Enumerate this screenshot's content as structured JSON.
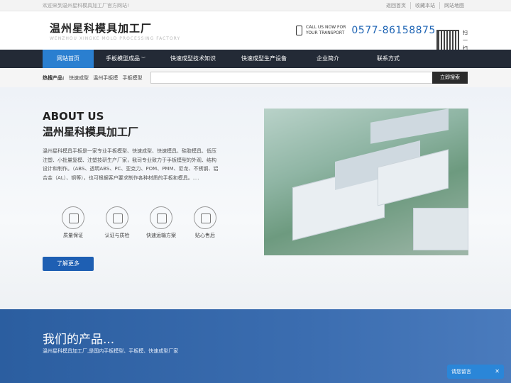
{
  "topbar": {
    "welcome": "欢迎来到温州星科模具加工厂官方网站!",
    "links": [
      "返回首页",
      "收藏本站",
      "网站地图"
    ]
  },
  "header": {
    "brand_cn": "温州星科模具加工厂",
    "brand_en": "WENZHOU XINGKE MOLD PROCESSING FACTORY",
    "call_line1": "CALL US NOW FOR",
    "call_line2": "YOUR TRANSPORT",
    "phone": "0577-86158875",
    "qr_label": "扫一扫"
  },
  "nav": {
    "items": [
      {
        "label": "网站首页",
        "active": true
      },
      {
        "label": "手板模型成品"
      },
      {
        "label": "快速成型技术知识"
      },
      {
        "label": "快速成型生产设备"
      },
      {
        "label": "企业简介"
      },
      {
        "label": "联系方式"
      }
    ]
  },
  "search": {
    "hot_label": "热搜产品:",
    "hot_items": [
      "快速成型",
      "温州手板模",
      "手板模型"
    ],
    "placeholder": "",
    "button": "立即搜索"
  },
  "about": {
    "title_en": "ABOUT US",
    "title_cn": "温州星科模具加工厂",
    "text": "温州星科模具手板是一家专业手板模型、快速成型、快速模具、硅胶模具、低压注塑、小批量复模、注塑技研生产厂家，我司专业致力于手板模型的外观、结构设计和制作。（ABS、透明ABS、PC、亚克力、POM、PMM、尼龙、不锈钢、铝合金（AL）、铜等），也可根据客户要求制作各种材质的手板和模具。....",
    "features": [
      "质量保证",
      "认证与质检",
      "快速运输方案",
      "贴心售后"
    ],
    "more": "了解更多"
  },
  "products": {
    "title": "我们的产品...",
    "subtitle": "温州星科模具加工厂,是国内手板模型、手板模、快速成型厂家"
  },
  "chat": {
    "label": "请您留言",
    "close": "✕"
  }
}
